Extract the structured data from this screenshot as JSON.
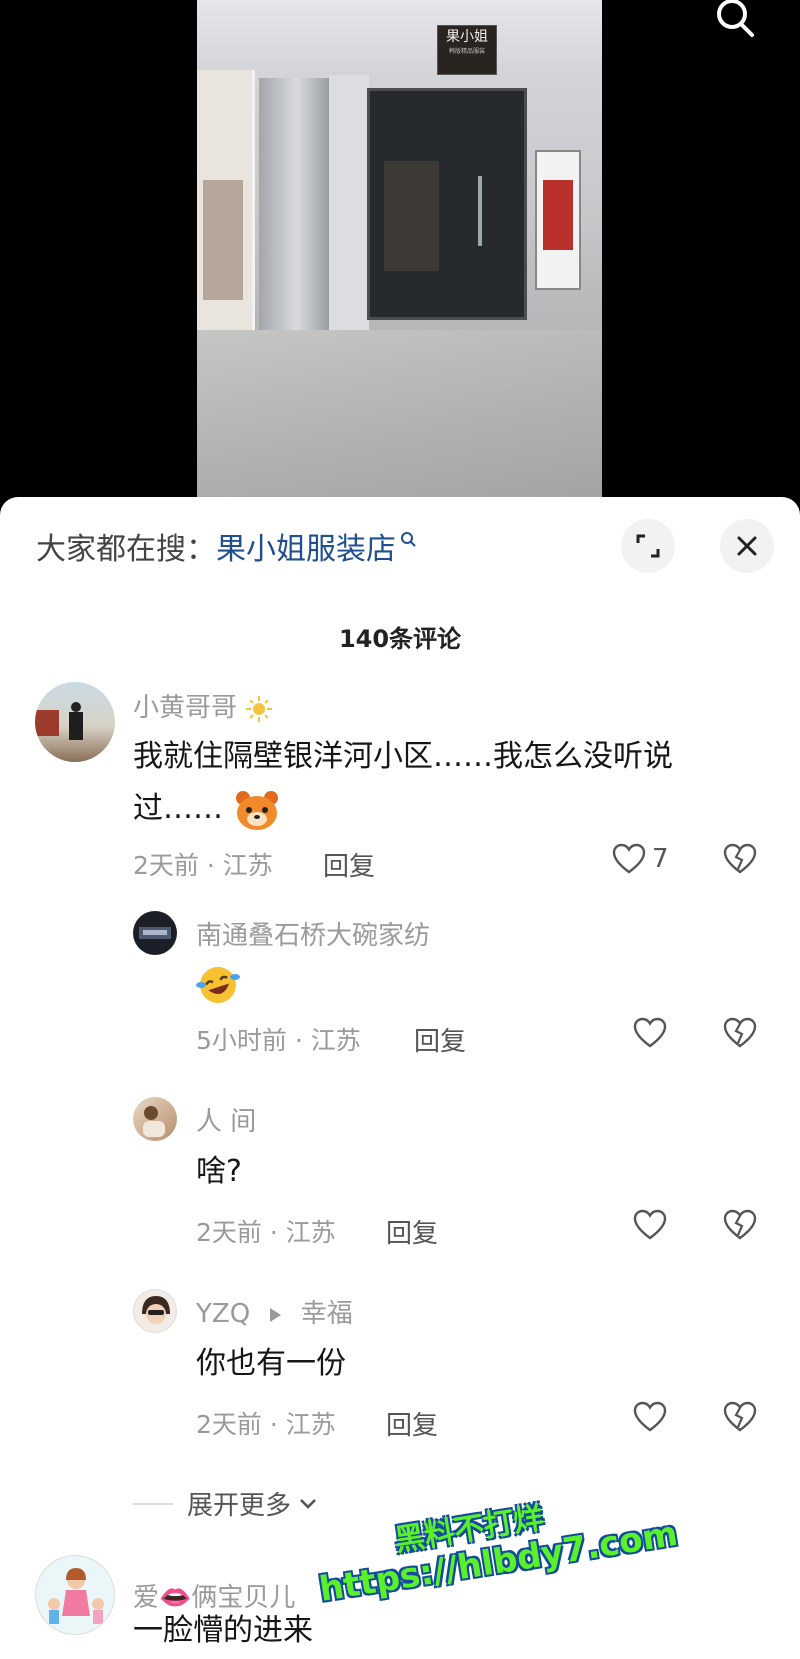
{
  "video": {
    "sign_text": "果小姐",
    "sign_subtext": "韩版精品服装"
  },
  "search_bar": {
    "label": "大家都在搜：",
    "keyword": "果小姐服装店"
  },
  "comments_header": {
    "count_label": "140条评论"
  },
  "comments": [
    {
      "username": "小黄哥哥",
      "text": "我就住隔壁银洋河小区……我怎么没听说过……",
      "time_location": "2天前 · 江苏",
      "reply_label": "回复",
      "likes": "7"
    },
    {
      "username": "南通叠石桥大碗家纺",
      "text": "",
      "time_location": "5小时前 · 江苏",
      "reply_label": "回复"
    },
    {
      "username": "人 间",
      "text": "啥?",
      "time_location": "2天前 · 江苏",
      "reply_label": "回复"
    },
    {
      "username": "YZQ",
      "reply_to": "幸福",
      "text": "你也有一份",
      "time_location": "2天前 · 江苏",
      "reply_label": "回复"
    },
    {
      "username": "爱👄俩宝贝儿",
      "text": "一脸懵的进来"
    }
  ],
  "expand_more_label": "展开更多",
  "watermark": {
    "line1": "黑料不打烊",
    "line2": "https://hlbdy7.com"
  },
  "colors": {
    "keyword": "#1f4f8f",
    "watermark_fill": "#5cf02a",
    "watermark_outline": "#114c9c"
  }
}
